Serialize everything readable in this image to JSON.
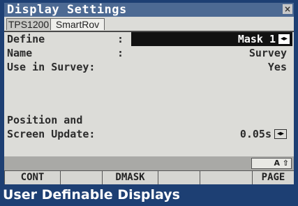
{
  "window": {
    "title": "Display Settings",
    "close_glyph": "×"
  },
  "tabs": [
    {
      "label": "TPS1200"
    },
    {
      "label": "SmartRov"
    }
  ],
  "fields": {
    "define": {
      "label": "Define",
      "colon": ":",
      "value": "Mask 1"
    },
    "name": {
      "label": "Name",
      "colon": ":",
      "value": "Survey"
    },
    "use_in_survey": {
      "label": "Use in Survey:",
      "value": "Yes"
    },
    "position_line1": "Position and",
    "screen_update": {
      "label": "Screen Update:",
      "value": "0.05s"
    }
  },
  "spin_glyph": "◂▸",
  "shift_indicator": "A ⇧",
  "softkeys": [
    "CONT",
    "",
    "DMASK",
    "",
    "",
    "PAGE"
  ],
  "caption": "User Definable Displays",
  "colors": {
    "frame": "#1d3f73",
    "titlebar": "#4d6a93",
    "screen_bg": "#dcdcd8",
    "selection": "#111111"
  }
}
